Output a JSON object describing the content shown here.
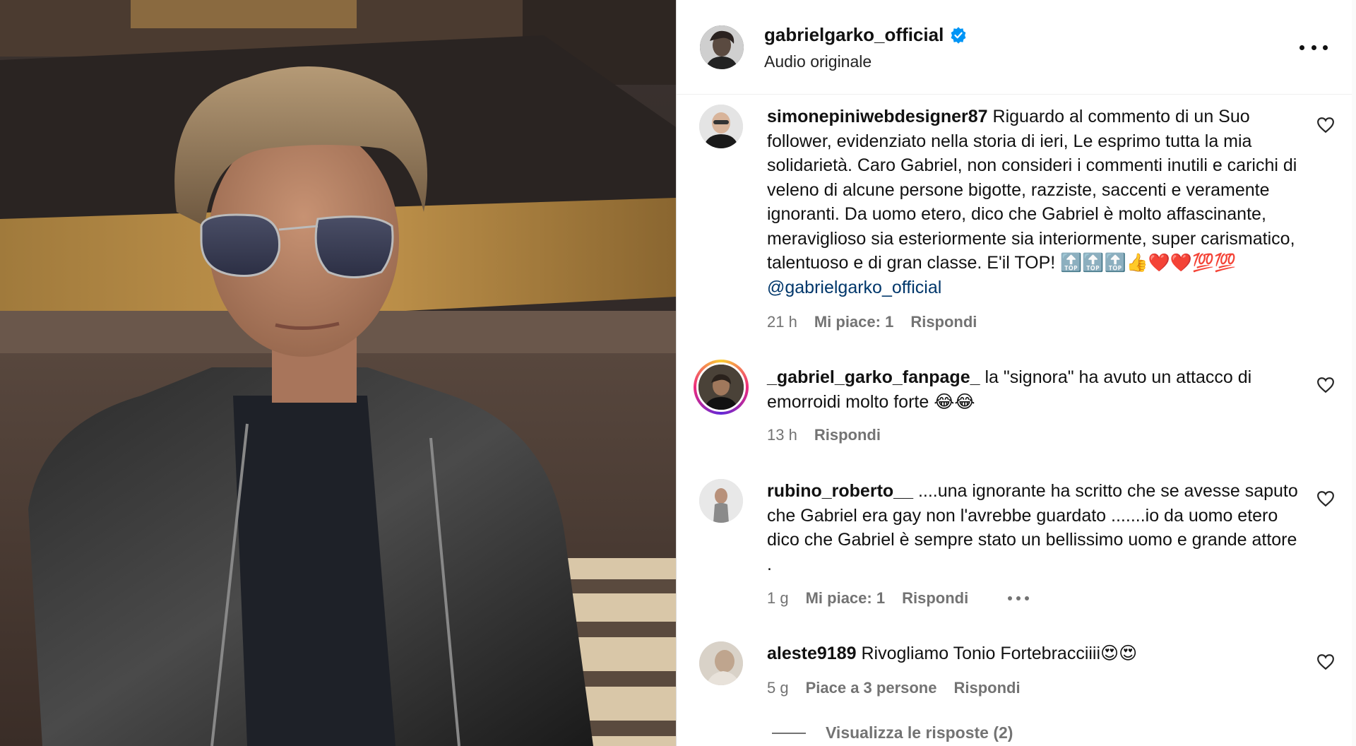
{
  "post": {
    "username": "gabrielgarko_official",
    "verified_icon": "verified-badge-icon",
    "audio_label": "Audio originale",
    "more_icon": "more-options-icon"
  },
  "comments": [
    {
      "username": "simonepiniwebdesigner87",
      "text": "Riguardo al commento di un Suo follower, evidenziato nella storia di ieri, Le esprimo tutta la mia solidarietà. Caro Gabriel, non consideri i commenti inutili e carichi di veleno di alcune persone bigotte, razziste, saccenti e veramente ignoranti. Da uomo etero, dico che Gabriel è molto affascinante, meraviglioso sia esteriormente sia interiormente, super carismatico, talentuoso e di gran classe. E'il TOP! 🔝🔝🔝👍❤️❤️💯💯",
      "mention": "@gabrielgarko_official",
      "time": "21 h",
      "likes": "Mi piace: 1",
      "reply": "Rispondi"
    },
    {
      "username": "_gabriel_garko_fanpage_",
      "text": "la \"signora\" ha avuto un attacco di emorroidi molto forte 😂😂",
      "time": "13 h",
      "reply": "Rispondi"
    },
    {
      "username": "rubino_roberto__",
      "text": "....una ignorante ha scritto che se avesse saputo che Gabriel era gay non l'avrebbe guardato .......io da uomo etero dico che Gabriel è sempre stato un bellissimo uomo e grande attore .",
      "time": "1 g",
      "likes": "Mi piace: 1",
      "reply": "Rispondi"
    },
    {
      "username": "aleste9189",
      "text": "Rivogliamo Tonio Fortebracciiii😍😍",
      "time": "5 g",
      "likes": "Piace a 3 persone",
      "reply": "Rispondi"
    }
  ],
  "view_replies": "Visualizza le risposte (2)",
  "colors": {
    "meta_gray": "#737373",
    "mention_blue": "#00376b",
    "verified_blue": "#0095f6"
  }
}
